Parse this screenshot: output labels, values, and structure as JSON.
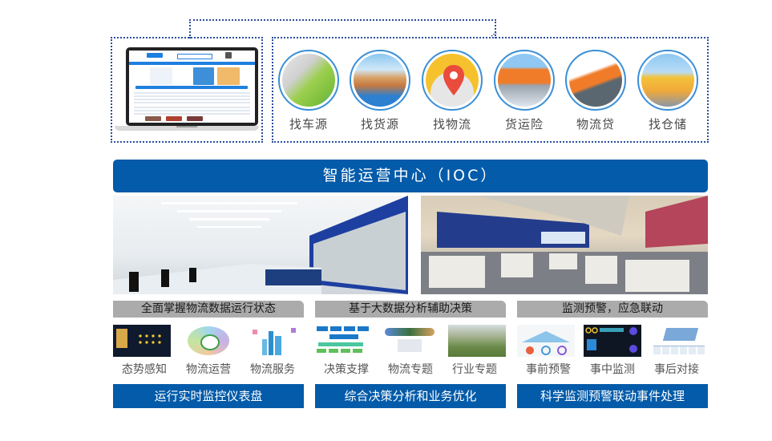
{
  "platform": {
    "website_preview": "logistics-portal-screenshot",
    "services": [
      {
        "label": "找车源",
        "icon": "map-roads-trucks-icon"
      },
      {
        "label": "找货源",
        "icon": "truck-boxes-workers-icon"
      },
      {
        "label": "找物流",
        "icon": "map-pin-route-icon"
      },
      {
        "label": "货运险",
        "icon": "shield-container-truck-icon"
      },
      {
        "label": "物流贷",
        "icon": "lock-truck-scale-icon"
      },
      {
        "label": "找仓储",
        "icon": "forklift-pallet-icon"
      }
    ]
  },
  "ioc": {
    "title": "智能运营中心（IOC）",
    "photos": [
      "control-room-video-wall",
      "command-center-hall"
    ]
  },
  "columns": [
    {
      "header": "全面掌握物流数据运行状态",
      "items": [
        "态势感知",
        "物流运营",
        "物流服务"
      ],
      "footer": "运行实时监控仪表盘"
    },
    {
      "header": "基于大数据分析辅助决策",
      "items": [
        "决策支撑",
        "物流专题",
        "行业专题"
      ],
      "footer": "综合决策分析和业务优化"
    },
    {
      "header": "监测预警，应急联动",
      "items": [
        "事前预警",
        "事中监测",
        "事后对接"
      ],
      "footer": "科学监测预警联动事件处理"
    }
  ],
  "colors": {
    "primary_blue": "#035ba9",
    "header_gray": "#ababab",
    "dotted_border": "#2a4e9c",
    "circle_border": "#3a8fd8"
  }
}
